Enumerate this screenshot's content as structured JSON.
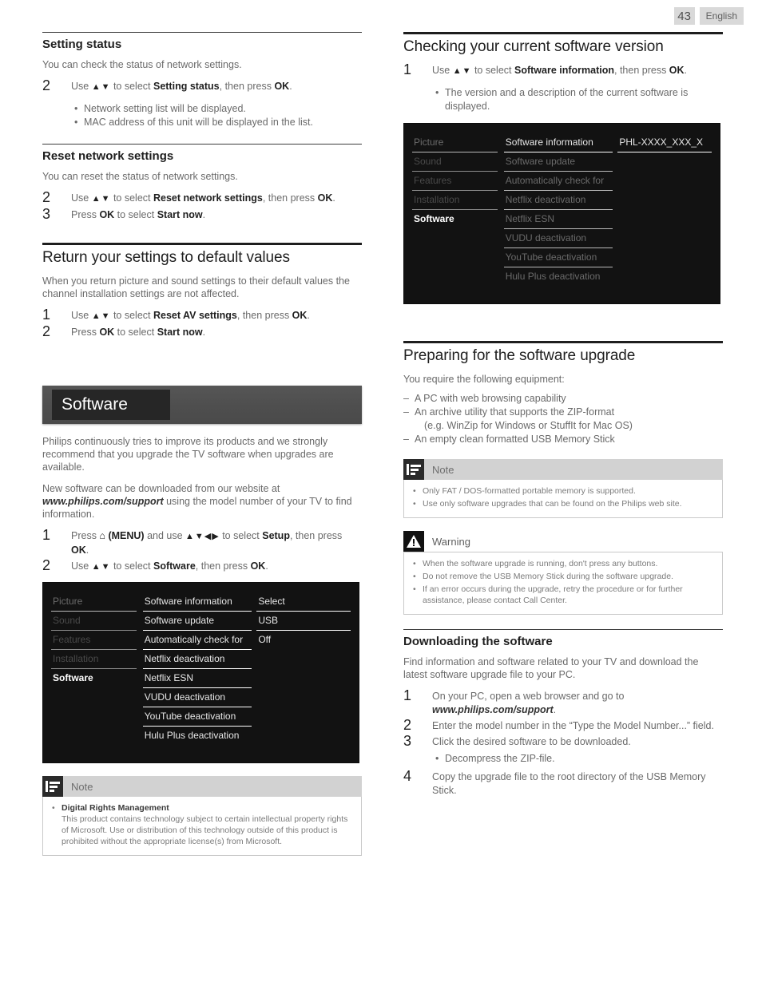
{
  "header": {
    "page_number": "43",
    "language": "English"
  },
  "left_column": {
    "setting_status": {
      "title": "Setting status",
      "intro": "You can check the status of network settings.",
      "steps": [
        {
          "num": "2",
          "prefix": "Use ",
          "arrows": "▲▼",
          "mid": " to select ",
          "bold": "Setting status",
          "suffix": ", then press ",
          "key": "OK",
          "end": "."
        }
      ],
      "bullets": [
        "Network setting list will be displayed.",
        "MAC address of this unit will be displayed in the list."
      ]
    },
    "reset_network": {
      "title": "Reset network settings",
      "intro": "You can reset the status of network settings.",
      "steps": [
        {
          "num": "2",
          "prefix": "Use ",
          "arrows": "▲▼",
          "mid": " to select ",
          "bold": "Reset network settings",
          "suffix": ", then press ",
          "key": "OK",
          "end": "."
        },
        {
          "num": "3",
          "prefix": "Press ",
          "key_lead": "OK",
          "mid": " to select ",
          "bold": "Start now",
          "end": "."
        }
      ]
    },
    "return_defaults": {
      "title": "Return your settings to default values",
      "intro": "When you return picture and sound settings to their default values the channel installation settings are not affected.",
      "steps": [
        {
          "num": "1",
          "prefix": "Use ",
          "arrows": "▲▼",
          "mid": " to select ",
          "bold": "Reset AV settings",
          "suffix": ", then press ",
          "key": "OK",
          "end": "."
        },
        {
          "num": "2",
          "prefix": "Press ",
          "key_lead": "OK",
          "mid": " to select ",
          "bold": "Start now",
          "end": "."
        }
      ]
    },
    "software_banner": {
      "label": "Software"
    },
    "software_intro": {
      "para1": "Philips continuously tries to improve its products and we strongly recommend that you upgrade the TV software when upgrades are available.",
      "para2_a": "New software can be downloaded from our website at ",
      "para2_url": "www.philips.com/support",
      "para2_b": " using the model number of your TV to find information.",
      "steps": [
        {
          "num": "1",
          "prefix": "Press ",
          "home": "⌂ (MENU)",
          "mid": " and use ",
          "arrows": "▲▼◀▶",
          "mid2": " to select ",
          "bold": "Setup",
          "suffix": ", then press ",
          "key": "OK",
          "end": "."
        },
        {
          "num": "2",
          "prefix": "Use ",
          "arrows": "▲▼",
          "mid": " to select ",
          "bold": "Software",
          "suffix": ", then press ",
          "key": "OK",
          "end": "."
        }
      ]
    },
    "tv_menu": {
      "col1": [
        "Picture",
        "Sound",
        "Features",
        "Installation",
        "Software"
      ],
      "col1_selected": "Software",
      "col2": [
        "Software information",
        "Software update",
        "Automatically check for",
        "Netflix deactivation",
        "Netflix ESN",
        "VUDU deactivation",
        "YouTube deactivation",
        "Hulu Plus deactivation"
      ],
      "col3": [
        "Select",
        "USB",
        "Off"
      ]
    },
    "note": {
      "icon": "note-icon",
      "title": "Note",
      "items": [
        {
          "heading": "Digital Rights Management",
          "text": "This product contains technology subject to certain intellectual property rights of Microsoft. Use or distribution of this technology outside of this product is prohibited without the appropriate license(s) from Microsoft."
        }
      ]
    }
  },
  "right_column": {
    "checking_version": {
      "title": "Checking your current software version",
      "steps": [
        {
          "num": "1",
          "prefix": "Use ",
          "arrows": "▲▼",
          "mid": " to select ",
          "bold": "Software information",
          "suffix": ", then press ",
          "key": "OK",
          "end": "."
        }
      ],
      "bullets": [
        "The version and a description of the current software is displayed."
      ]
    },
    "tv_menu": {
      "col1": [
        "Picture",
        "Sound",
        "Features",
        "Installation",
        "Software"
      ],
      "col1_selected": "Software",
      "col2": [
        "Software information",
        "Software update",
        "Automatically check for",
        "Netflix deactivation",
        "Netflix ESN",
        "VUDU deactivation",
        "YouTube deactivation",
        "Hulu Plus deactivation"
      ],
      "col2_highlighted": "Software information",
      "col3": [
        "PHL-XXXX_XXX_X"
      ]
    },
    "preparing": {
      "title": "Preparing for the software upgrade",
      "intro": "You require the following equipment:",
      "items": [
        {
          "text": "A PC with web browsing capability",
          "cont": ""
        },
        {
          "text": "An archive utility that supports the ZIP-format",
          "cont": "(e.g. WinZip for Windows or StuffIt for Mac OS)"
        },
        {
          "text": "An empty clean formatted USB Memory Stick",
          "cont": ""
        }
      ]
    },
    "note": {
      "icon": "note-icon",
      "title": "Note",
      "items": [
        {
          "heading": "",
          "text": "Only FAT / DOS-formatted portable memory is supported."
        },
        {
          "heading": "",
          "text": "Use only software upgrades that can be found on the Philips web site."
        }
      ]
    },
    "warning": {
      "icon": "warning-icon",
      "title": "Warning",
      "items": [
        {
          "heading": "",
          "text": "When the software upgrade is running, don't press any buttons."
        },
        {
          "heading": "",
          "text": "Do not remove the USB Memory Stick during the software upgrade."
        },
        {
          "heading": "",
          "text": "If an error occurs during the upgrade, retry the procedure or for further assistance, please contact Call Center."
        }
      ]
    },
    "downloading": {
      "title": "Downloading the software",
      "intro": "Find information and software related to your TV and download the latest software upgrade file to your PC.",
      "steps": [
        {
          "num": "1",
          "text_a": "On your PC, open a web browser and go to ",
          "url": "www.philips.com/support",
          "text_b": "."
        },
        {
          "num": "2",
          "text_a": "Enter the model number in the “Type the Model Number...” field.",
          "url": "",
          "text_b": ""
        },
        {
          "num": "3",
          "text_a": "Click the desired software to be downloaded.",
          "url": "",
          "text_b": ""
        },
        {
          "num": "4",
          "text_a": "Copy the upgrade file to the root directory of the USB Memory Stick.",
          "url": "",
          "text_b": ""
        }
      ],
      "sub_bullets": [
        {
          "after_step": "3",
          "text": "Decompress the ZIP-file."
        }
      ]
    }
  },
  "colors": {
    "rule_dark": "#1e1e1e",
    "menu_bg": "#121212",
    "banner_gray": "#4e4e4e",
    "banner_box": "#262626",
    "callout_head": "#d2d2d2",
    "header_box": "#d9d9d9"
  }
}
